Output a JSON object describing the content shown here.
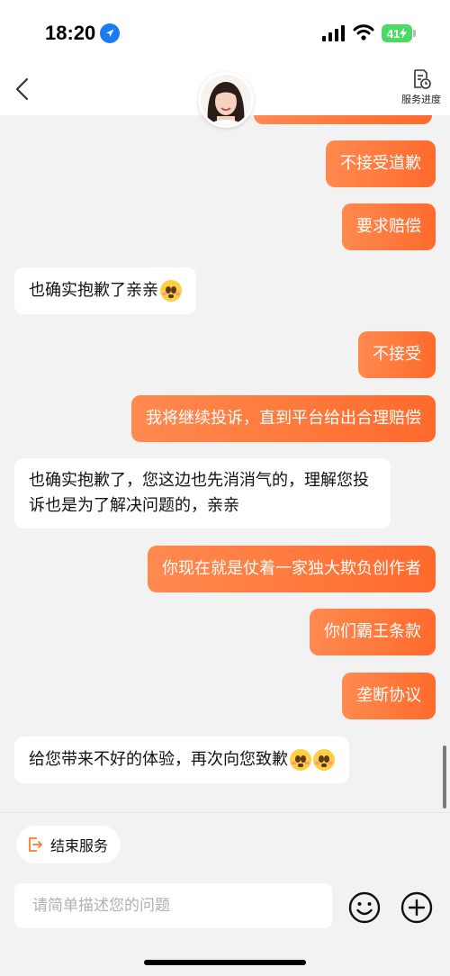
{
  "status_bar": {
    "time": "18:20",
    "battery": "41",
    "location_icon": "location-arrow-icon",
    "signal_icon": "cellular-signal-icon",
    "wifi_icon": "wifi-icon"
  },
  "nav": {
    "back_icon": "chevron-left-icon",
    "avatar_icon": "agent-avatar",
    "service_progress_label": "服务进度",
    "service_progress_icon": "document-clock-icon"
  },
  "messages": [
    {
      "side": "out",
      "text": "不接受道歉"
    },
    {
      "side": "out",
      "text": "要求赔偿"
    },
    {
      "side": "in",
      "text": "也确实抱歉了亲亲",
      "emoji": "pleading-face-icon"
    },
    {
      "side": "out",
      "text": "不接受"
    },
    {
      "side": "out",
      "text": "我将继续投诉，直到平台给出合理赔偿"
    },
    {
      "side": "in",
      "text": "也确实抱歉了，您这边也先消消气的，理解您投诉也是为了解决问题的，亲亲"
    },
    {
      "side": "out",
      "text": "你现在就是仗着一家独大欺负创作者"
    },
    {
      "side": "out",
      "text": "你们霸王条款"
    },
    {
      "side": "out",
      "text": "垄断协议"
    },
    {
      "side": "in",
      "text": "给您带来不好的体验，再次向您致歉",
      "emoji": "pleading-face-icon"
    }
  ],
  "bottom": {
    "end_service_label": "结束服务",
    "end_service_icon": "exit-icon",
    "input_placeholder": "请简单描述您的问题",
    "emoji_button_icon": "smiley-icon",
    "plus_button_icon": "plus-circle-icon"
  },
  "colors": {
    "outgoing_bubble_start": "#ff8a4f",
    "outgoing_bubble_end": "#ff6a2c",
    "incoming_bubble": "#ffffff",
    "background": "#f2f2f2",
    "accent": "#ff7a2f"
  }
}
